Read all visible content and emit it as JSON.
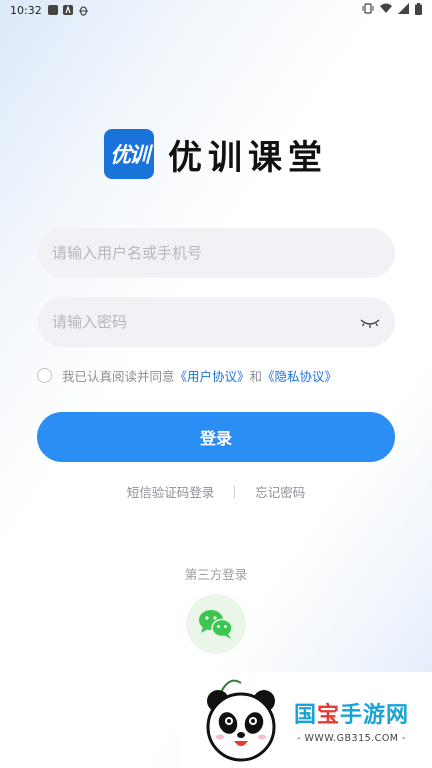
{
  "status_bar": {
    "time": "10:32",
    "left_icons": [
      "square-notification-icon",
      "a-notification-icon",
      "bug-notification-icon"
    ],
    "right_icons": [
      "vibrate-icon",
      "wifi-icon",
      "signal-icon",
      "battery-icon"
    ]
  },
  "brand": {
    "logo_text": "优训",
    "name": "优训课堂",
    "logo_color": "#1a73d9"
  },
  "form": {
    "username_placeholder": "请输入用户名或手机号",
    "username_value": "",
    "password_placeholder": "请输入密码",
    "password_value": ""
  },
  "agreement": {
    "checked": false,
    "prefix": "我已认真阅读并同意",
    "user_agreement": "《用户协议》",
    "and": "和",
    "privacy_policy": "《隐私协议》"
  },
  "login_button": "登录",
  "links": {
    "sms_login": "短信验证码登录",
    "forgot_password": "忘记密码"
  },
  "third_party": {
    "label": "第三方登录",
    "icon": "wechat-icon"
  },
  "watermark": {
    "title_a": "国",
    "title_b": "宝",
    "title_c": "手游网",
    "url": "- WWW.GB315.COM -"
  },
  "colors": {
    "accent": "#2b8ef5",
    "link": "#1a73d9",
    "wechat": "#3cc651"
  }
}
